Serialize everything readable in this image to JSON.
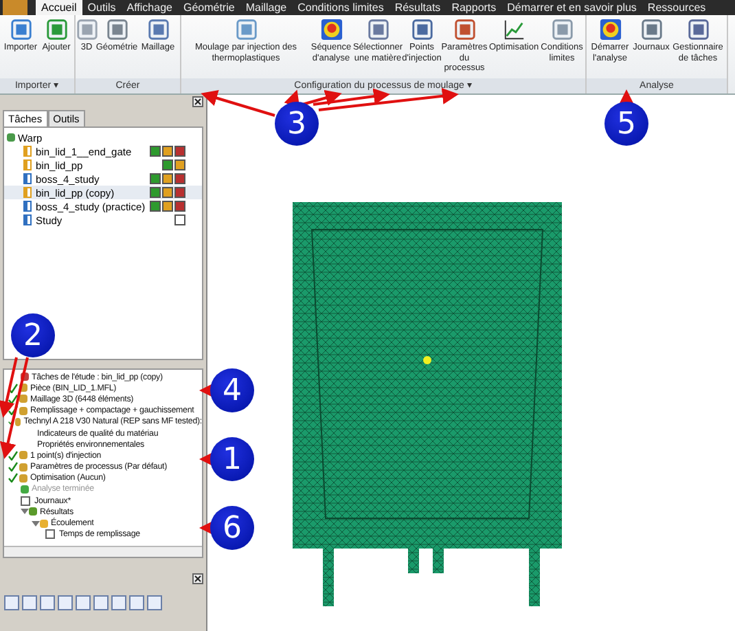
{
  "menu_tabs": [
    {
      "label": "Accueil",
      "selected": true
    },
    {
      "label": "Outils",
      "selected": false
    },
    {
      "label": "Affichage",
      "selected": false
    },
    {
      "label": "Géométrie",
      "selected": false
    },
    {
      "label": "Maillage",
      "selected": false
    },
    {
      "label": "Conditions limites",
      "selected": false
    },
    {
      "label": "Résultats",
      "selected": false
    },
    {
      "label": "Rapports",
      "selected": false
    },
    {
      "label": "Démarrer et en savoir plus",
      "selected": false
    },
    {
      "label": "Ressources",
      "selected": false
    }
  ],
  "ribbon_groups": [
    {
      "label": "Importer ▾",
      "buttons": [
        "Importer",
        "Ajouter"
      ]
    },
    {
      "label": "Créer",
      "buttons": [
        "3D",
        "Géométrie",
        "Maillage"
      ]
    },
    {
      "label": "Configuration du processus de moulage ▾",
      "buttons": [
        "Moulage par injection des thermoplastiques",
        "Séquence d'analyse",
        "Sélectionner une matière",
        "Points d'injection",
        "Paramètres du processus",
        "Optimisation",
        "Conditions limites"
      ]
    },
    {
      "label": "Analyse",
      "buttons": [
        "Démarrer l'analyse",
        "Journaux",
        "Gestionnaire de tâches"
      ]
    }
  ],
  "panel_tabs": [
    {
      "label": "Tâches",
      "selected": true
    },
    {
      "label": "Outils",
      "selected": false
    }
  ],
  "project": {
    "name": "Warp",
    "studies": [
      {
        "name": "bin_lid_1__end_gate",
        "color": "#e0a020",
        "selected": false,
        "badges": [
          {
            "color": "#2e9a2e"
          },
          {
            "color": "#e0a020"
          },
          {
            "color": "#b83030"
          }
        ]
      },
      {
        "name": "bin_lid_pp",
        "color": "#e0a020",
        "selected": false,
        "badges": [
          {
            "color": "#2e9a2e"
          },
          {
            "color": "#e0a020"
          }
        ]
      },
      {
        "name": "boss_4_study",
        "color": "#3070c0",
        "selected": false,
        "badges": [
          {
            "color": "#2e9a2e"
          },
          {
            "color": "#e0a020"
          },
          {
            "color": "#b83030"
          }
        ]
      },
      {
        "name": "bin_lid_pp (copy)",
        "color": "#e0a020",
        "selected": true,
        "badges": [
          {
            "color": "#2e9a2e"
          },
          {
            "color": "#e0a020"
          },
          {
            "color": "#b83030"
          }
        ]
      },
      {
        "name": "boss_4_study (practice)",
        "color": "#3070c0",
        "selected": false,
        "badges": [
          {
            "color": "#2e9a2e"
          },
          {
            "color": "#e0a020"
          },
          {
            "color": "#b83030"
          }
        ]
      },
      {
        "name": "Study",
        "color": "#3070c0",
        "selected": false,
        "badges": [
          {
            "color": "#ffffff"
          }
        ]
      }
    ]
  },
  "study_tasks": [
    {
      "kind": "header",
      "label": "Tâches de l'étude : bin_lid_pp (copy)"
    },
    {
      "kind": "step",
      "label": "Pièce (BIN_LID_1.MFL)",
      "checked": true
    },
    {
      "kind": "step",
      "label": "Maillage 3D (6448 éléments)",
      "checked": true
    },
    {
      "kind": "step",
      "label": "Remplissage + compactage + gauchissement",
      "checked": true
    },
    {
      "kind": "step",
      "label": "Technyl A 218 V30 Natural (REP sans MF tested):",
      "checked": true,
      "children": [
        {
          "label": "Indicateurs de qualité du matériau"
        },
        {
          "label": "Propriétés environnementales"
        }
      ]
    },
    {
      "kind": "step",
      "label": "1 point(s) d'injection",
      "checked": true
    },
    {
      "kind": "step",
      "label": "Paramètres de processus (Par défaut)",
      "checked": true
    },
    {
      "kind": "step",
      "label": "Optimisation (Aucun)",
      "checked": true
    },
    {
      "kind": "status",
      "label": "Analyse terminée"
    },
    {
      "kind": "box",
      "label": "Journaux*",
      "checked": false
    },
    {
      "kind": "folder",
      "label": "Résultats",
      "expanded": true,
      "children": [
        {
          "label": "Écoulement",
          "expanded": true,
          "children": [
            {
              "label": "Temps de remplissage",
              "checked": false
            }
          ]
        }
      ]
    }
  ],
  "annotations": [
    "1",
    "2",
    "3",
    "4",
    "5",
    "6"
  ]
}
